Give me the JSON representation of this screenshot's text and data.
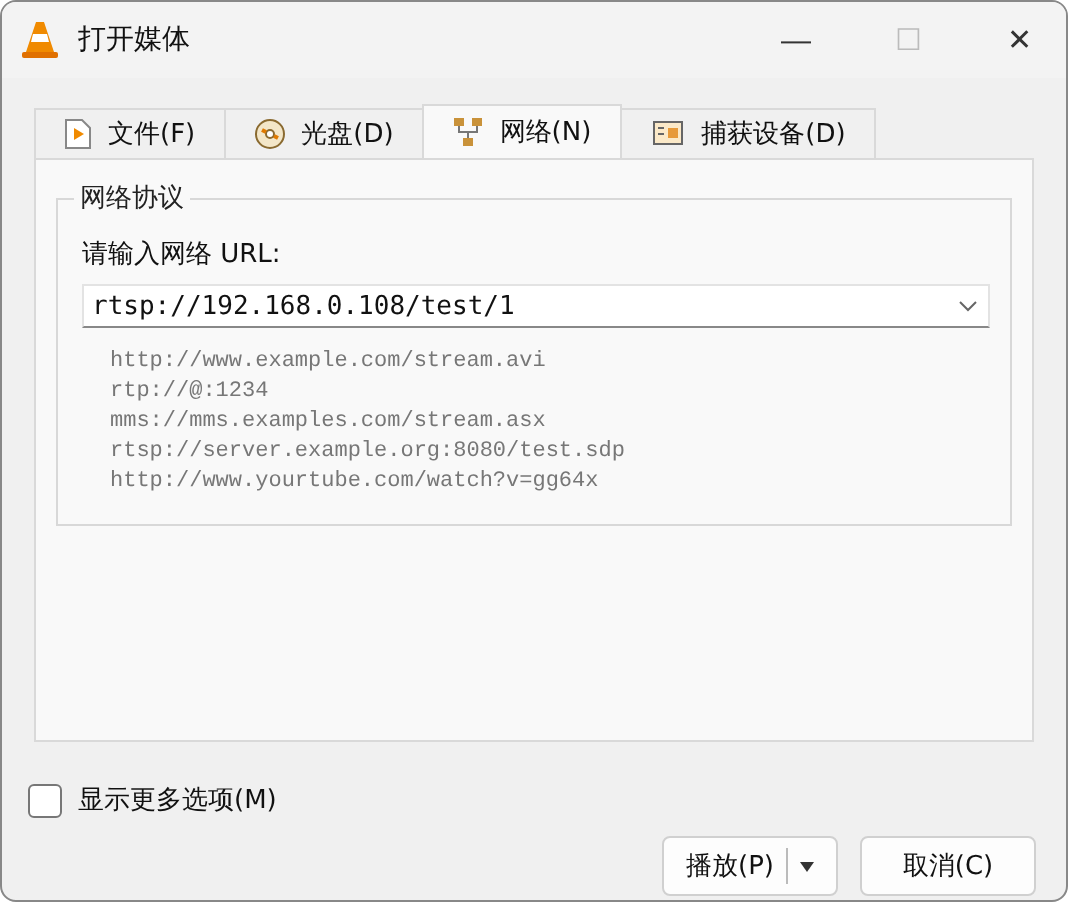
{
  "window": {
    "title": "打开媒体",
    "controls": [
      "—",
      "☐",
      "✕"
    ]
  },
  "tabs": [
    {
      "label": "文件(F)",
      "kind": "file",
      "selected": false
    },
    {
      "label": "光盘(D)",
      "kind": "disc",
      "selected": false
    },
    {
      "label": "网络(N)",
      "kind": "network",
      "selected": true
    },
    {
      "label": "捕获设备(D)",
      "kind": "capture",
      "selected": false
    }
  ],
  "group": {
    "title": "网络协议",
    "prompt": "请输入网络 URL:",
    "url": "rtsp://192.168.0.108/test/1",
    "examples": [
      "http://www.example.com/stream.avi",
      "rtp://@:1234",
      "mms://mms.examples.com/stream.asx",
      "rtsp://server.example.org:8080/test.sdp",
      "http://www.yourtube.com/watch?v=gg64x"
    ]
  },
  "more_options": {
    "label": "显示更多选项(M)",
    "checked": false
  },
  "buttons": [
    {
      "label": "播放(P)",
      "kind": "split"
    },
    {
      "label": "取消(C)",
      "kind": "plain"
    }
  ]
}
